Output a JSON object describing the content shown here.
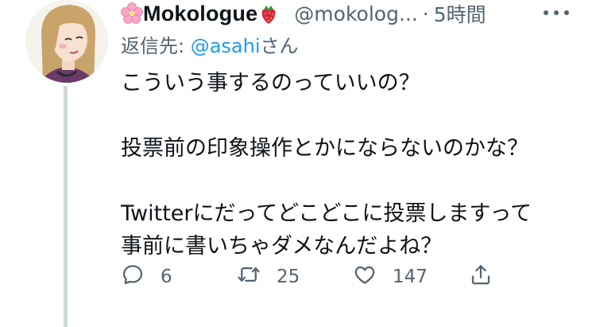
{
  "tweet": {
    "display_name": "Mokologue",
    "handle": "@mokolog...",
    "separator": "·",
    "time": "5時間",
    "reply_label": "返信先: ",
    "reply_mention": "@asahi",
    "reply_suffix": "さん",
    "lines": [
      "こういう事するのっていいの？",
      "投票前の印象操作とかにならないのかな？",
      "Twitterにだってどこどこに投票しますって",
      "事前に書いちゃダメなんだよね？"
    ]
  },
  "actions": {
    "reply_count": "6",
    "retweet_count": "25",
    "like_count": "147"
  },
  "colors": {
    "secondary_text": "#536471",
    "mention_blue": "#1d9bf0",
    "thread_line": "#cfd9de"
  },
  "icons": [
    "cherry-blossom-icon",
    "strawberry-icon",
    "more-icon",
    "reply-icon",
    "retweet-icon",
    "like-icon",
    "share-icon"
  ]
}
